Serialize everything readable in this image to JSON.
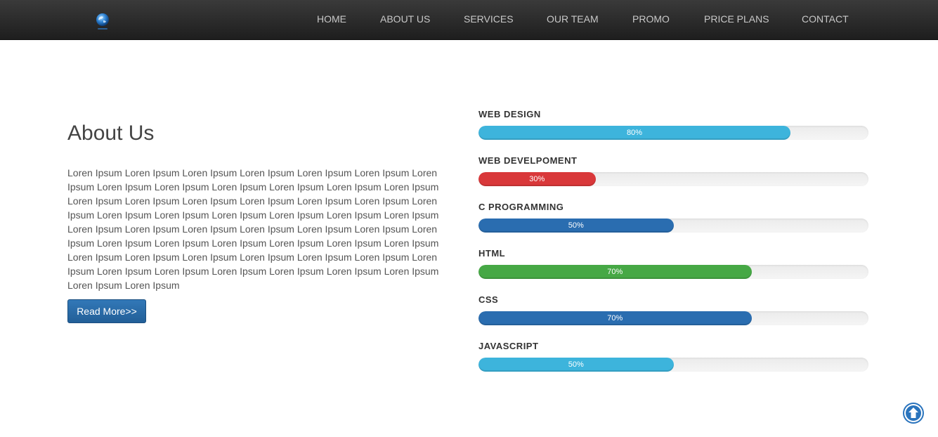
{
  "nav": {
    "items": [
      {
        "label": "HOME"
      },
      {
        "label": "ABOUT US"
      },
      {
        "label": "SERVICES"
      },
      {
        "label": "OUR TEAM"
      },
      {
        "label": "PROMO"
      },
      {
        "label": "PRICE PLANS"
      },
      {
        "label": "CONTACT"
      }
    ]
  },
  "about": {
    "title": "About Us",
    "text": "Loren Ipsum Loren Ipsum Loren Ipsum Loren Ipsum Loren Ipsum Loren Ipsum Loren Ipsum Loren Ipsum Loren Ipsum Loren Ipsum Loren Ipsum Loren Ipsum Loren Ipsum Loren Ipsum Loren Ipsum Loren Ipsum Loren Ipsum Loren Ipsum Loren Ipsum Loren Ipsum Loren Ipsum Loren Ipsum Loren Ipsum Loren Ipsum Loren Ipsum Loren Ipsum Loren Ipsum Loren Ipsum Loren Ipsum Loren Ipsum Loren Ipsum Loren Ipsum Loren Ipsum Loren Ipsum Loren Ipsum Loren Ipsum Loren Ipsum Loren Ipsum Loren Ipsum Loren Ipsum Loren Ipsum Loren Ipsum Loren Ipsum Loren Ipsum Loren Ipsum Loren Ipsum Loren Ipsum Loren Ipsum Loren Ipsum Loren Ipsum Loren Ipsum Loren Ipsum Loren Ipsum Loren Ipsum",
    "button_label": "Read More>>"
  },
  "skills": [
    {
      "name": "WEB DESIGN",
      "value": 80,
      "percent_label": "80%",
      "color": "#3db4dc"
    },
    {
      "name": "WEB DEVELPOMENT",
      "value": 30,
      "percent_label": "30%",
      "color": "#d9383a"
    },
    {
      "name": "C PROGRAMMING",
      "value": 50,
      "percent_label": "50%",
      "color": "#2a6db0"
    },
    {
      "name": "HTML",
      "value": 70,
      "percent_label": "70%",
      "color": "#46a845"
    },
    {
      "name": "CSS",
      "value": 70,
      "percent_label": "70%",
      "color": "#2a6db0"
    },
    {
      "name": "JAVASCRIPT",
      "value": 50,
      "percent_label": "50%",
      "color": "#3db4dc"
    }
  ],
  "icons": {
    "logo": "globe-logo-icon",
    "scroll_top": "arrow-up-circle-icon"
  },
  "colors": {
    "topbar": "#1e1e1e",
    "accent": "#2a74bd"
  }
}
